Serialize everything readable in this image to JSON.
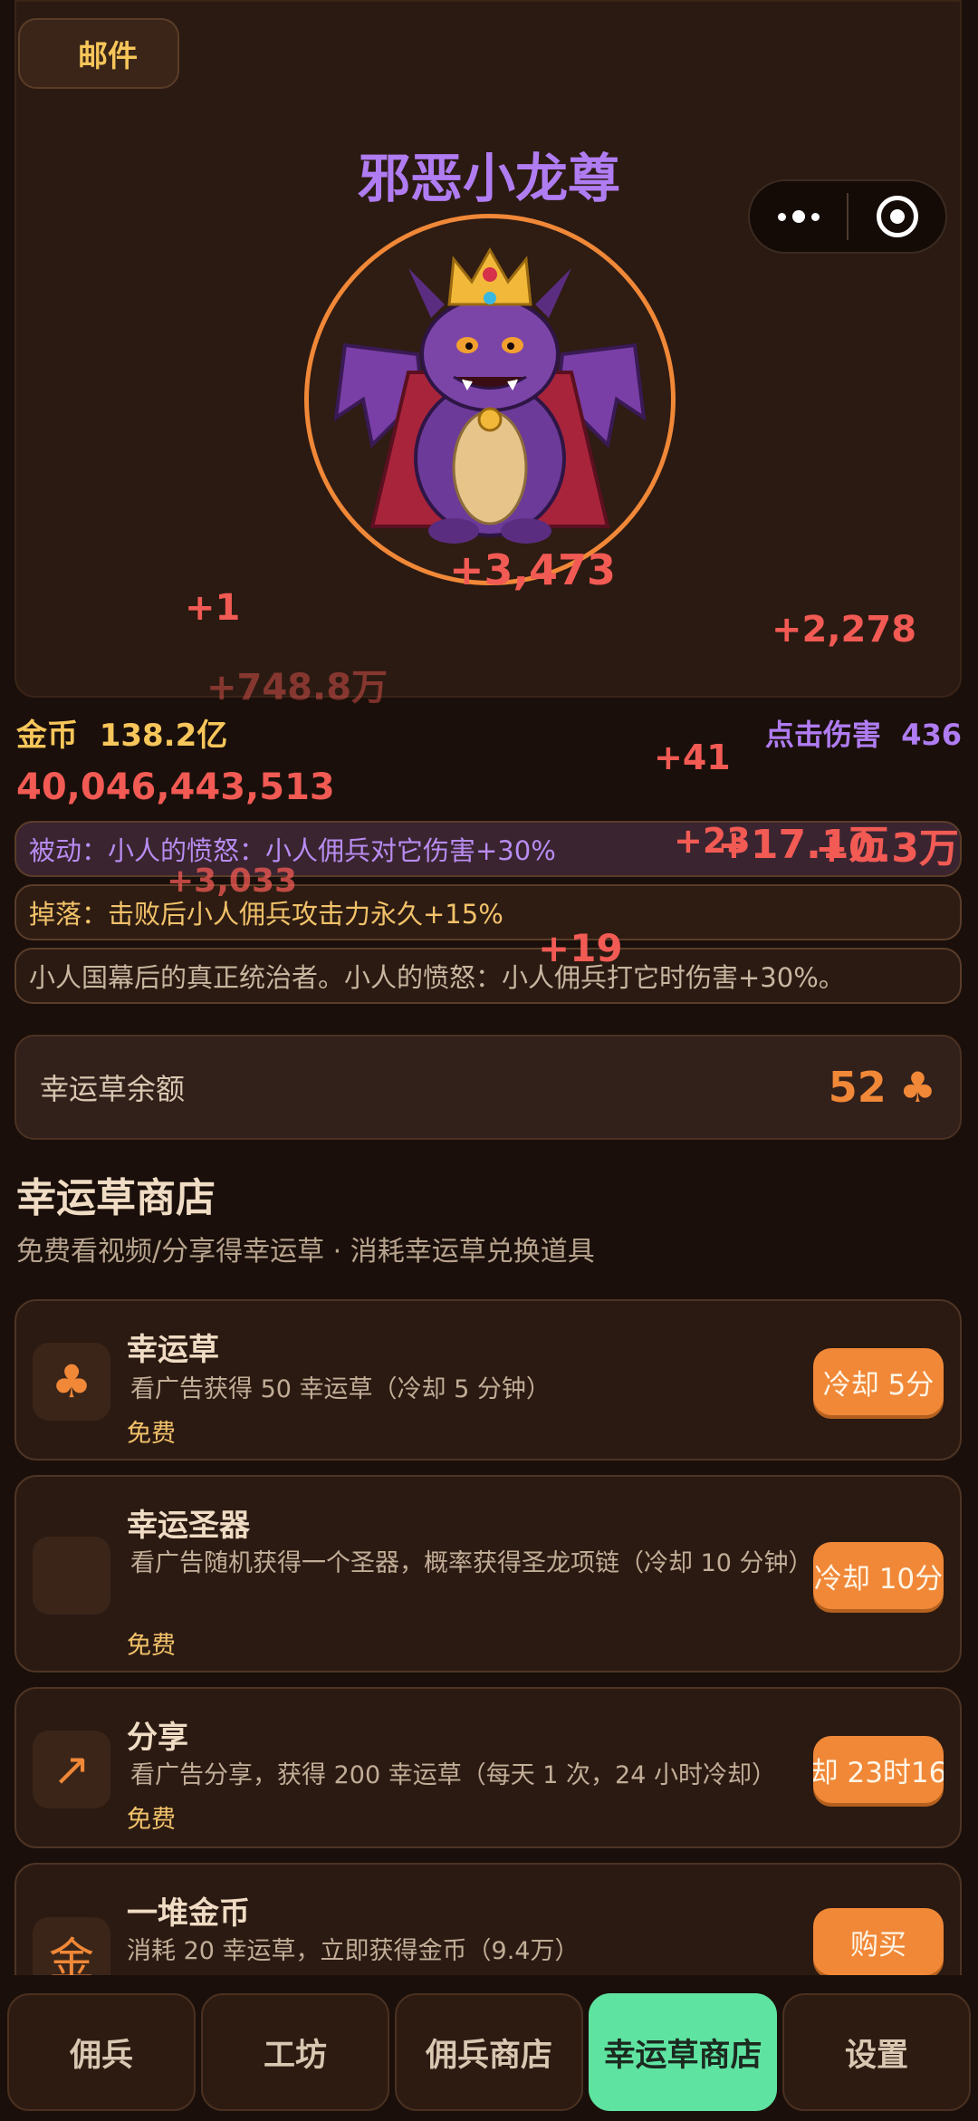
{
  "mail": {
    "label": "邮件"
  },
  "boss": {
    "name": "邪恶小龙尊",
    "damage_popups": [
      "+3,473",
      "+1",
      "+2,278",
      "+748.8万",
      "+41",
      "+23",
      "+17.1万",
      "+0.3万",
      "+3,033",
      "+19"
    ]
  },
  "stats": {
    "gold_label": "金币",
    "gold_value": "138.2亿",
    "click_label": "点击伤害",
    "click_value": "436",
    "hp": "40,046,443,513"
  },
  "info": {
    "passive": "被动：小人的愤怒：小人佣兵对它伤害+30%",
    "drop": "掉落：击败后小人佣兵攻击力永久+15%",
    "desc": "小人国幕后的真正统治者。小人的愤怒：小人佣兵打它时伤害+30%。"
  },
  "balance": {
    "label": "幸运草余额",
    "value": "52",
    "icon": "clover-icon"
  },
  "shop": {
    "title": "幸运草商店",
    "subtitle": "免费看视频/分享得幸运草 · 消耗幸运草兑换道具",
    "items": [
      {
        "title": "幸运草",
        "desc": "看广告获得 50 幸运草（冷却 5 分钟）",
        "tag": "免费",
        "button": "冷却 5分",
        "icon": "clover-icon",
        "glyph": "♣"
      },
      {
        "title": "幸运圣器",
        "desc": "看广告随机获得一个圣器，概率获得圣龙项链（冷却 10 分钟）",
        "tag": "免费",
        "button": "冷却 10分",
        "icon": "artifact-icon",
        "glyph": ""
      },
      {
        "title": "分享",
        "desc": "看广告分享，获得 200 幸运草（每天 1 次，24 小时冷却）",
        "tag": "免费",
        "button": "却 23时16",
        "icon": "share-arrow-icon",
        "glyph": "↗"
      },
      {
        "title": "一堆金币",
        "desc": "消耗 20 幸运草，立即获得金币（9.4万）",
        "tag": "",
        "button": "购买",
        "icon": "gold-icon",
        "glyph": "金"
      }
    ]
  },
  "nav": [
    "佣兵",
    "工坊",
    "佣兵商店",
    "幸运草商店",
    "设置"
  ],
  "colors": {
    "accent": "#f08838",
    "purple": "#b07cf2",
    "damage": "#f25a54",
    "gold": "#f7c65a",
    "active_tab": "#5fe3a1"
  }
}
